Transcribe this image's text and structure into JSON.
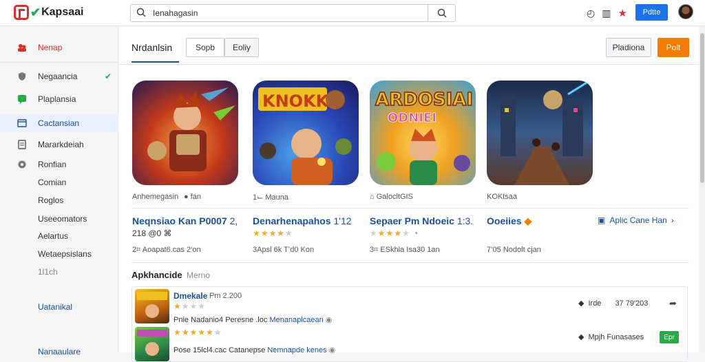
{
  "app": {
    "name": "Kapsaai"
  },
  "search": {
    "value": "Ienahagasin",
    "placeholder": ""
  },
  "header": {
    "login_label": "Pdtte"
  },
  "sidebar": {
    "items": [
      {
        "label": "Nenap"
      },
      {
        "label": "Negaancia"
      },
      {
        "label": "Plaplansia"
      },
      {
        "label": "Cactansian"
      },
      {
        "label": "Mararkdeiah"
      },
      {
        "label": "Ronfian"
      }
    ],
    "subitems": [
      "Comian",
      "Roglos",
      "Useeomators",
      "Aelartus",
      "Wetaepsislans",
      "1l1ch"
    ],
    "bottom": [
      "Uatanikal",
      "Nanaaulare"
    ]
  },
  "tabs": {
    "main_label": "Nrdanlsin",
    "pill1": "Sopb",
    "pill2": "Eoliy",
    "right1": "Pladiona",
    "right2": "Polt"
  },
  "games": [
    {
      "label": "Anhemegasin",
      "label_icon": "● fan",
      "title": "Neqnsiao Kan P0007",
      "title_num": "2,",
      "sub": "218 @0 ⌘",
      "meta": "2⌗ Aoapat6.cas 2‘on"
    },
    {
      "label": "1⌙ Mauna",
      "title": "Denarhenapahos",
      "title_num": "1'12",
      "sub": "",
      "meta": "3Apsl 6k T’d0 Kon"
    },
    {
      "label": "GalocltGIS",
      "title": "Sepaer Pm Ndoeic",
      "title_num": "1:3.",
      "sub": "",
      "meta": "3⌗ ESkhla Isa30 1an"
    },
    {
      "label": "KOKtsaa",
      "title": "Ooeiies",
      "title_num": "",
      "sub": "",
      "meta": "7’05 Nodolt cjan"
    }
  ],
  "more_link": "Aplic Cane Han",
  "section": {
    "title": "Apkhancide",
    "subtitle": "Merno"
  },
  "list": [
    {
      "title": "Dmekale",
      "small": "Pm 2.200",
      "desc_a": "Pnie Nadanio4 Peresne .loc",
      "desc_link": "Menanaplcaean",
      "right_a": "Irde",
      "right_b": "37 79'203"
    },
    {
      "title": "",
      "small": "",
      "desc_a": "Pose 15lcl4.cac Catanepse",
      "desc_link": "Nemnapde kenes",
      "right_a": "Mpjh Funasases",
      "badge": "Epr"
    }
  ],
  "colors": {
    "accent": "#1a4f9c",
    "brand": "#d9302c",
    "orange": "#f57c00",
    "green": "#2aa84a"
  }
}
